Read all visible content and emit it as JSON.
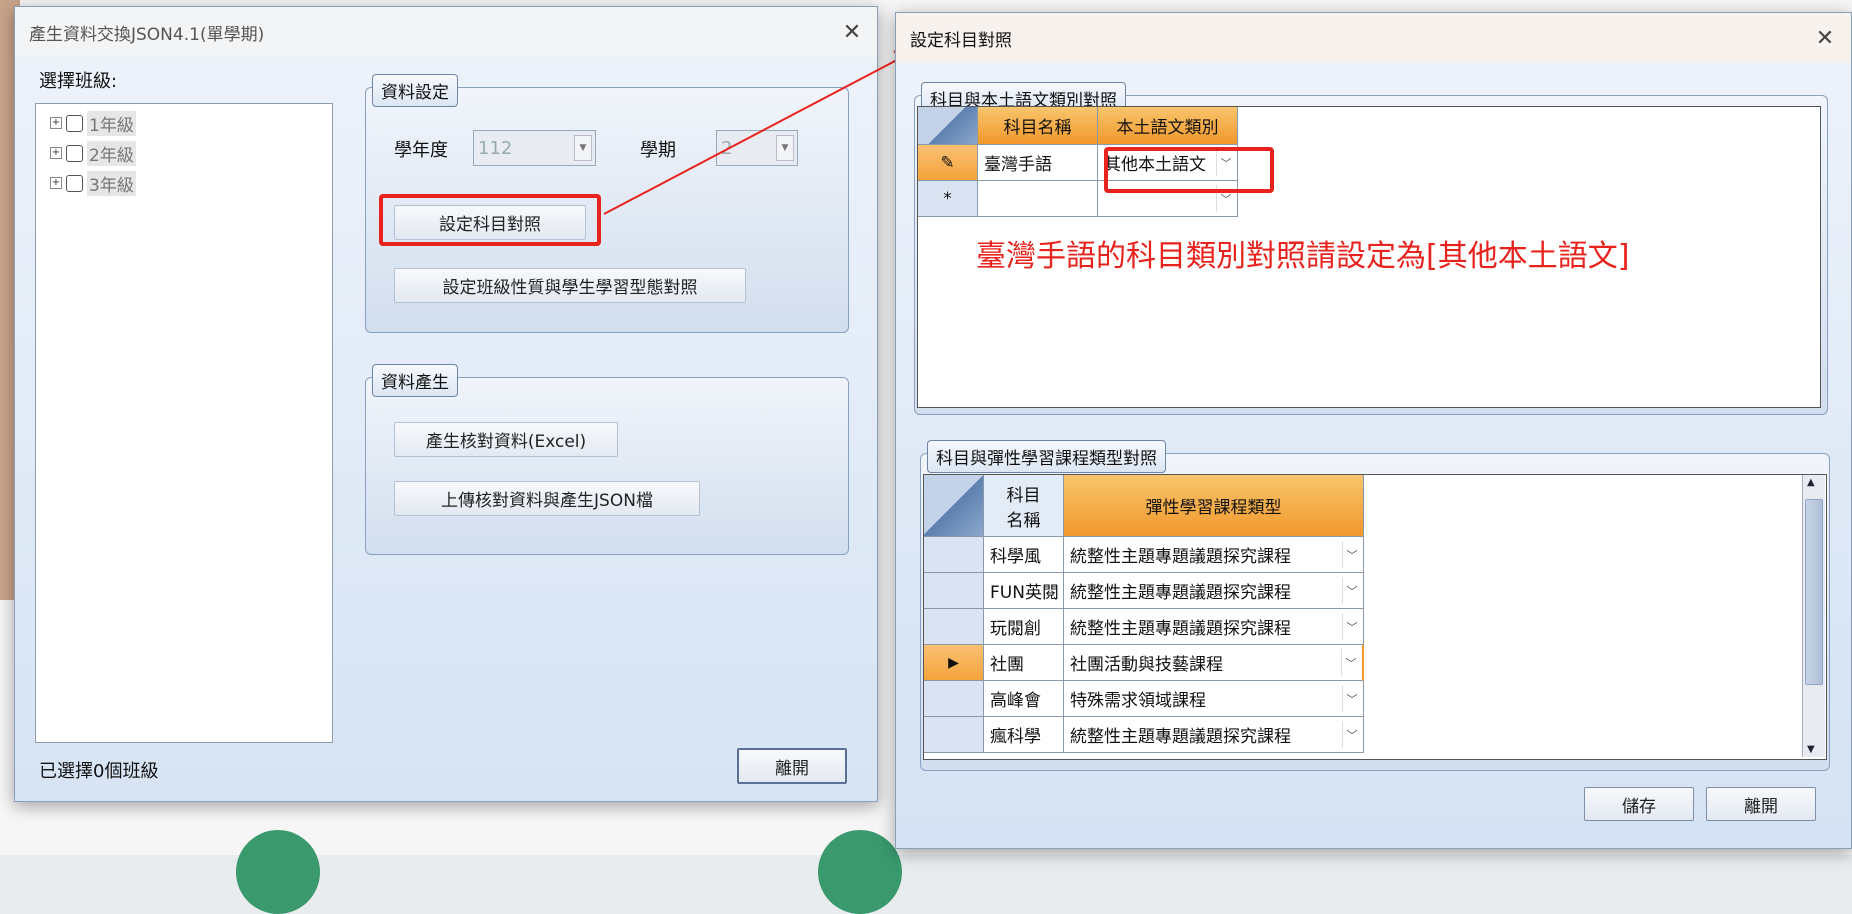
{
  "background": {
    "nav_items": [
      "",
      "",
      ""
    ]
  },
  "left_window": {
    "title": "產生資料交換JSON4.1(單學期)",
    "select_class_label": "選擇班級:",
    "tree_items": [
      {
        "label": "1年級"
      },
      {
        "label": "2年級"
      },
      {
        "label": "3年級"
      }
    ],
    "group_settings": {
      "caption": "資料設定",
      "year_label": "學年度",
      "year_value": "112",
      "term_label": "學期",
      "term_value": "2",
      "subject_map_button": "設定科目對照",
      "class_nature_button": "設定班級性質與學生學習型態對照"
    },
    "group_generate": {
      "caption": "資料產生",
      "verify_excel_button": "產生核對資料(Excel)",
      "upload_json_button": "上傳核對資料與產生JSON檔"
    },
    "status": "已選擇0個班級",
    "leave_button": "離開"
  },
  "right_window": {
    "title": "設定科目對照",
    "group1": {
      "caption": "科目與本土語文類別對照",
      "headers": [
        "科目名稱",
        "本土語文類別"
      ],
      "rows": [
        {
          "subject": "臺灣手語",
          "category": "其他本土語文",
          "marker": "✎"
        },
        {
          "subject": "",
          "category": "",
          "marker": "*"
        }
      ]
    },
    "annotation": "臺灣手語的科目類別對照請設定為[其他本土語文]",
    "group2": {
      "caption": "科目與彈性學習課程類型對照",
      "headers": [
        "科目\n名稱",
        "彈性學習課程類型"
      ],
      "rows": [
        {
          "subject": "科學風",
          "type": "統整性主題專題議題探究課程"
        },
        {
          "subject": "FUN英閱",
          "type": "統整性主題專題議題探究課程"
        },
        {
          "subject": "玩閱創",
          "type": "統整性主題專題議題探究課程"
        },
        {
          "subject": "社團",
          "type": "社團活動與技藝課程",
          "selected": true
        },
        {
          "subject": "高峰會",
          "type": "特殊需求領域課程"
        },
        {
          "subject": "瘋科學",
          "type": "統整性主題專題議題探究課程"
        }
      ]
    },
    "save_button": "儲存",
    "leave_button": "離開"
  },
  "colors": {
    "accent": "#f1982b",
    "annotation": "#e8231d"
  }
}
